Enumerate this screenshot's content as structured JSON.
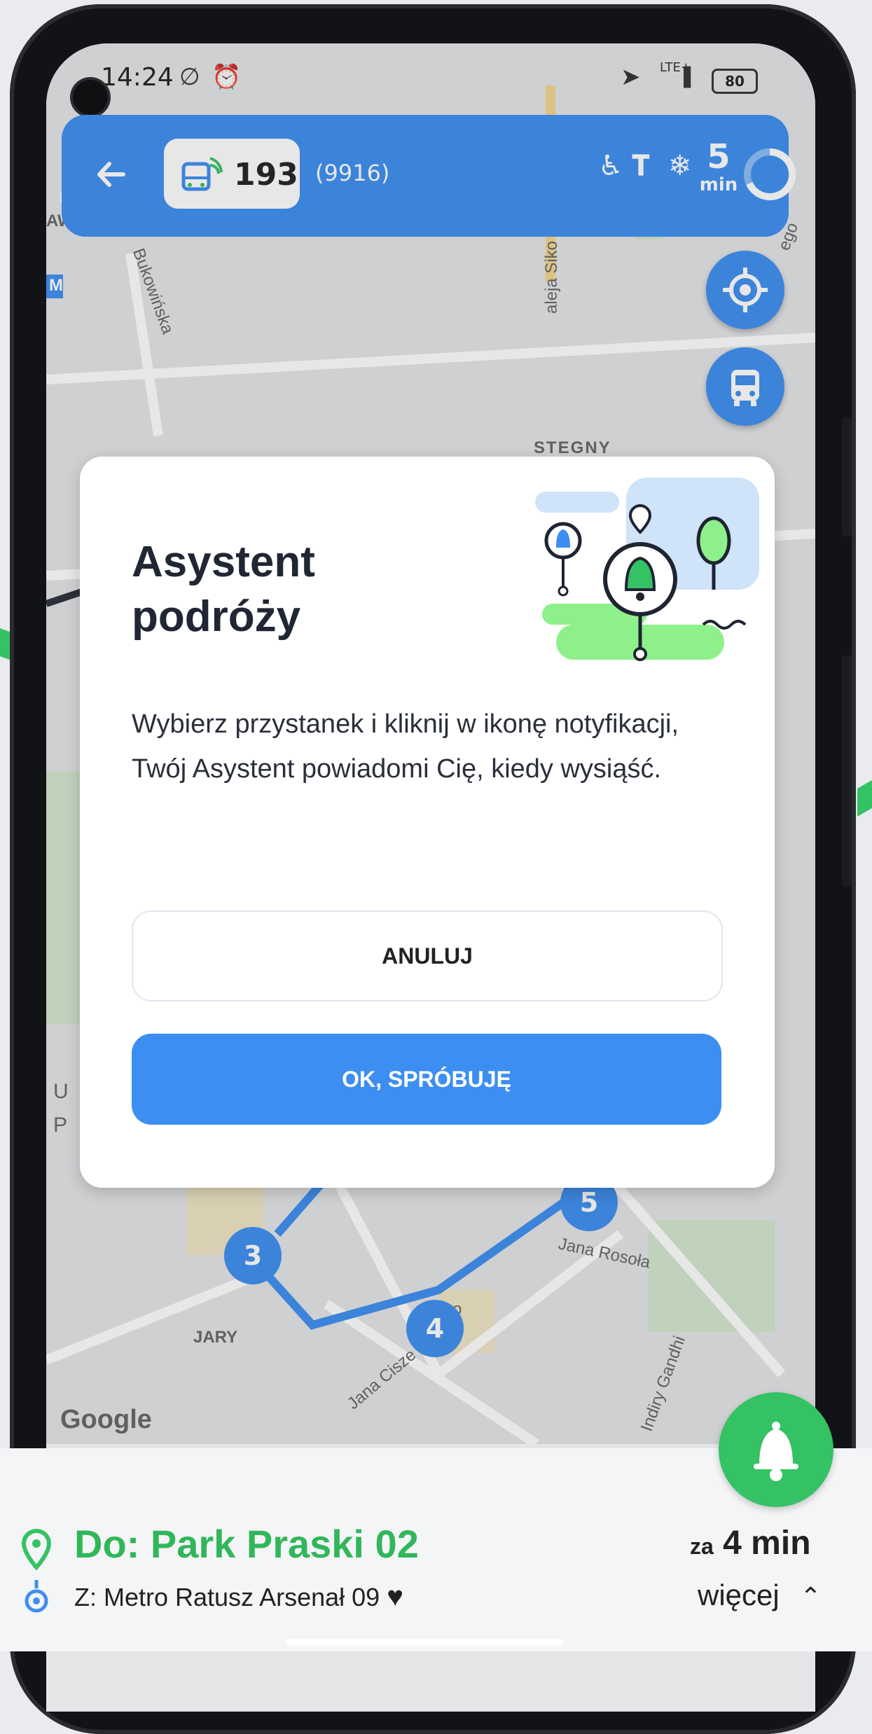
{
  "status": {
    "time": "14:24",
    "network": "LTE+",
    "battery": "80"
  },
  "topbar": {
    "line_number": "193",
    "vehicle_id": "(9916)",
    "minutes": "5",
    "minutes_unit": "min"
  },
  "map": {
    "labels": {
      "bukowinska": "Bukowińska",
      "aleja": "aleja Siko",
      "stegny": "STEGNY",
      "jary": "JARY",
      "rosola": "Jana Rosoła",
      "cisze": "Jana Cisze",
      "gandhi": "Indiry Gandhi",
      "u": "U",
      "p": "P",
      "m": "M",
      "aw": "AW",
      "ego": "ego",
      "o": "o"
    },
    "stops": [
      "3",
      "4",
      "5"
    ],
    "attribution": "Google"
  },
  "dialog": {
    "title": "Asystent podróży",
    "body": "Wybierz przystanek i kliknij w ikonę notyfikacji, Twój Asystent powiadomi Cię, kiedy wysiąść.",
    "cancel_label": "ANULUJ",
    "ok_label": "OK, SPRÓBUJĘ"
  },
  "trip": {
    "destination": "Do: Park Praski 02",
    "origin": "Z: Metro Ratusz Arsenał 09",
    "eta_prefix": "za",
    "eta_value": "4 min",
    "more_label": "więcej"
  },
  "colors": {
    "accent": "#3d8ef1",
    "green": "#35c264",
    "text": "#202633"
  }
}
